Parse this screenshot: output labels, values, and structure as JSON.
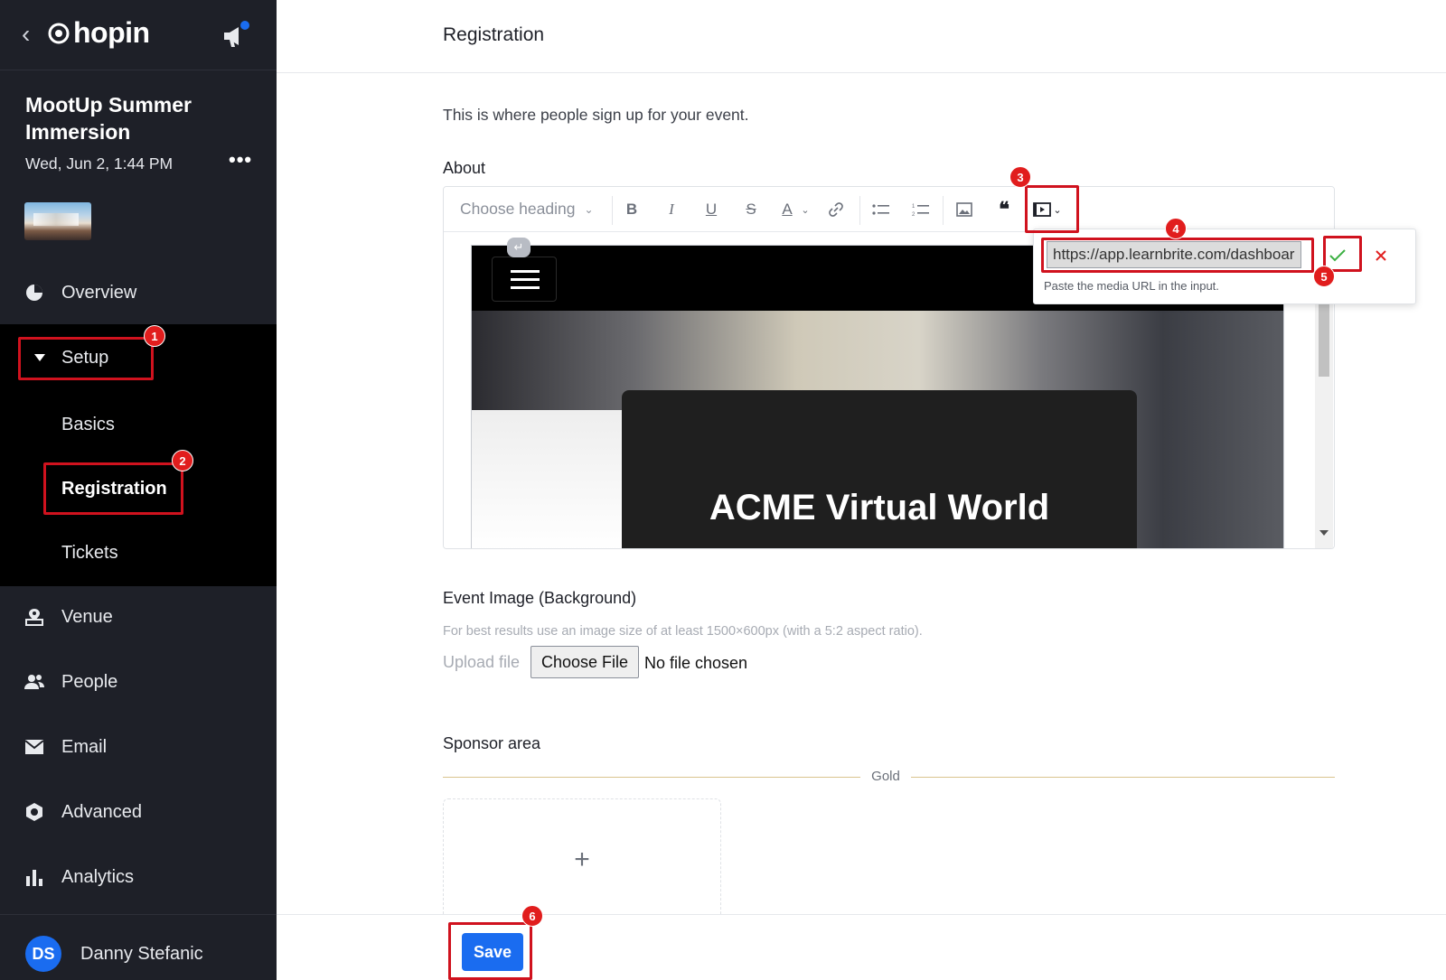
{
  "sidebar": {
    "logo": "hopin",
    "event_title": "MootUp Summer Immersion",
    "event_date": "Wed, Jun 2, 1:44 PM",
    "nav": {
      "overview": "Overview",
      "setup": "Setup",
      "basics": "Basics",
      "registration": "Registration",
      "tickets": "Tickets",
      "venue": "Venue",
      "people": "People",
      "email": "Email",
      "advanced": "Advanced",
      "analytics": "Analytics"
    },
    "user": {
      "initials": "DS",
      "name": "Danny Stefanic"
    }
  },
  "header": {
    "title": "Registration"
  },
  "main": {
    "intro": "This is where people sign up for your event.",
    "about_label": "About",
    "editor": {
      "heading_placeholder": "Choose heading",
      "embed_title": "ACME Virtual World",
      "media_url": "https://app.learnbrite.com/dashboar",
      "media_hint": "Paste the media URL in the input."
    },
    "event_image": {
      "label": "Event Image (Background)",
      "hint": "For best results use an image size of at least 1500×600px (with a 5:2 aspect ratio).",
      "upload_label": "Upload file",
      "choose_button": "Choose File",
      "no_file": "No file chosen"
    },
    "sponsor": {
      "label": "Sponsor area",
      "tier": "Gold",
      "add_symbol": "+"
    }
  },
  "footer": {
    "save_label": "Save"
  },
  "annotations": [
    "1",
    "2",
    "3",
    "4",
    "5",
    "6"
  ],
  "colors": {
    "accent": "#1a6cf0",
    "annotation": "#d0121e",
    "sidebar_bg": "#1e2028"
  }
}
